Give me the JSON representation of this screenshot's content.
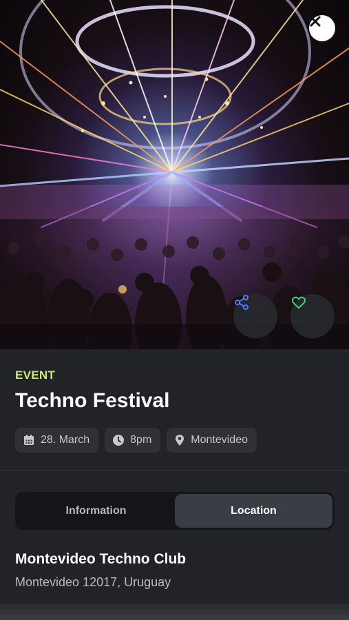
{
  "hero": {
    "image_alt": "",
    "close_icon": "close-icon",
    "share_icon": "share-icon",
    "favorite_icon": "heart-icon",
    "share_color": "#4a7cff",
    "favorite_color": "#3fd17a"
  },
  "event": {
    "tag": "EVENT",
    "title": "Techno Festival",
    "tag_color": "#c8ec6a"
  },
  "chips": [
    {
      "icon": "calendar-icon",
      "label": "28. March"
    },
    {
      "icon": "clock-icon",
      "label": "8pm"
    },
    {
      "icon": "location-pin-icon",
      "label": "Montevideo"
    }
  ],
  "tabs": [
    {
      "label": "Information",
      "active": false
    },
    {
      "label": "Location",
      "active": true
    }
  ],
  "location": {
    "venue": "Montevideo Techno Club",
    "address": "Montevideo 12017, Uruguay"
  }
}
